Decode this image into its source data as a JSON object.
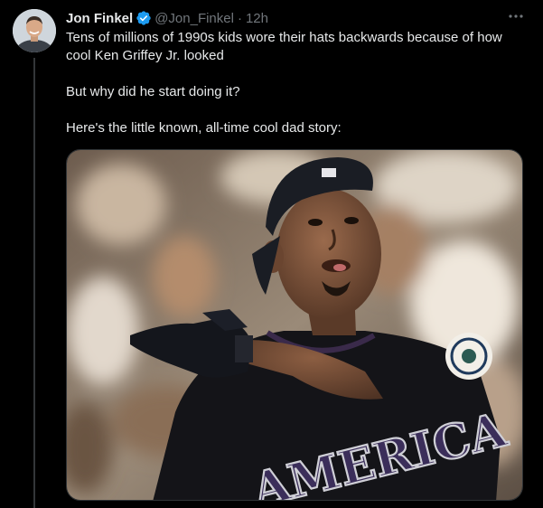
{
  "author": {
    "name": "Jon Finkel",
    "handle": "@Jon_Finkel",
    "separator": "·",
    "time": "12h",
    "verified": true,
    "avatar_icon": "profile-photo"
  },
  "more_icon": "ellipsis-icon",
  "tweet": {
    "lines": [
      "Tens of millions of 1990s kids wore their hats backwards because of how cool Ken Griffey Jr. looked",
      "But why did he start doing it?",
      "Here's the little known, all-time cool dad story:"
    ]
  },
  "media": {
    "jersey_text": "AMERICA"
  },
  "colors": {
    "background": "#000000",
    "text": "#e7e9ea",
    "secondary": "#71767b",
    "verified_blue": "#1d9bf0"
  }
}
